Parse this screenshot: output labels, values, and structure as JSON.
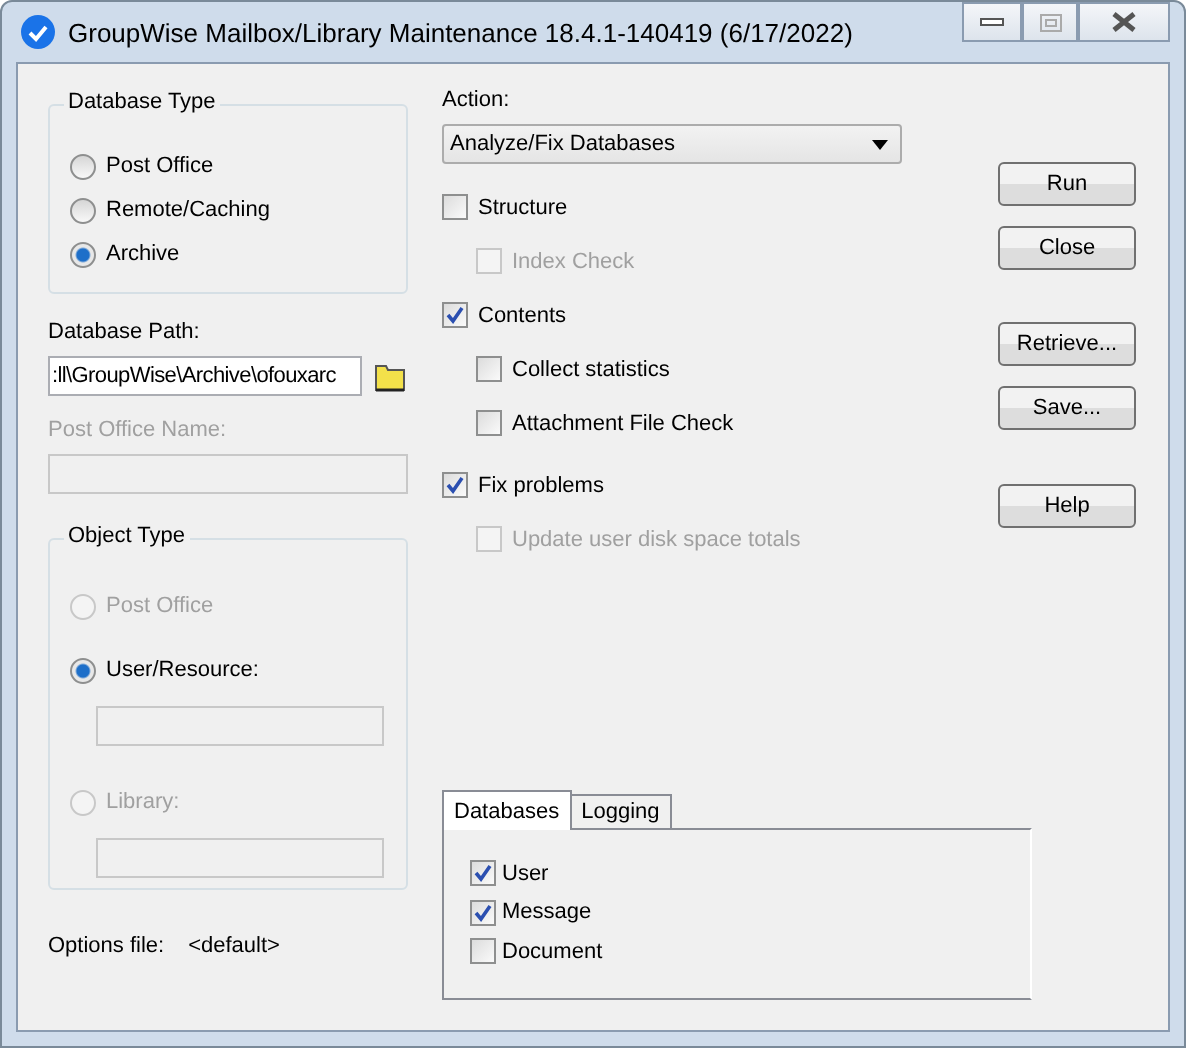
{
  "window": {
    "title": "GroupWise Mailbox/Library Maintenance 18.4.1-140419 (6/17/2022)"
  },
  "database_type": {
    "label": "Database Type",
    "options": [
      {
        "label": "Post Office",
        "selected": false
      },
      {
        "label": "Remote/Caching",
        "selected": false
      },
      {
        "label": "Archive",
        "selected": true
      }
    ]
  },
  "database_path": {
    "label": "Database Path:",
    "value": ":ll\\GroupWise\\Archive\\ofouxarc"
  },
  "post_office_name": {
    "label": "Post Office Name:",
    "disabled": true
  },
  "object_type": {
    "label": "Object Type",
    "options": [
      {
        "label": "Post Office",
        "selected": false,
        "disabled": true,
        "kind": "plain"
      },
      {
        "label": "User/Resource:",
        "selected": true,
        "disabled": false,
        "kind": "field"
      },
      {
        "label": "Library:",
        "selected": false,
        "disabled": true,
        "kind": "field"
      }
    ]
  },
  "options_file": {
    "label": "Options file:",
    "value": "<default>"
  },
  "action": {
    "label": "Action:",
    "value": "Analyze/Fix Databases"
  },
  "checks": [
    {
      "label": "Structure",
      "checked": false,
      "disabled": false,
      "children": [
        {
          "label": "Index Check",
          "checked": false,
          "disabled": true
        }
      ]
    },
    {
      "label": "Contents",
      "checked": true,
      "disabled": false,
      "children": [
        {
          "label": "Collect statistics",
          "checked": false,
          "disabled": false
        },
        {
          "label": "Attachment File Check",
          "checked": false,
          "disabled": false
        }
      ]
    },
    {
      "label": "Fix problems",
      "checked": true,
      "disabled": false,
      "children": [
        {
          "label": "Update user disk space totals",
          "checked": false,
          "disabled": true
        }
      ]
    }
  ],
  "buttons": [
    "Run",
    "Close",
    "Retrieve...",
    "Save...",
    "Help"
  ],
  "tabs": [
    {
      "label": "Databases",
      "selected": true
    },
    {
      "label": "Logging",
      "selected": false
    }
  ],
  "databases": [
    {
      "label": "User",
      "checked": true
    },
    {
      "label": "Message",
      "checked": true
    },
    {
      "label": "Document",
      "checked": false
    }
  ]
}
